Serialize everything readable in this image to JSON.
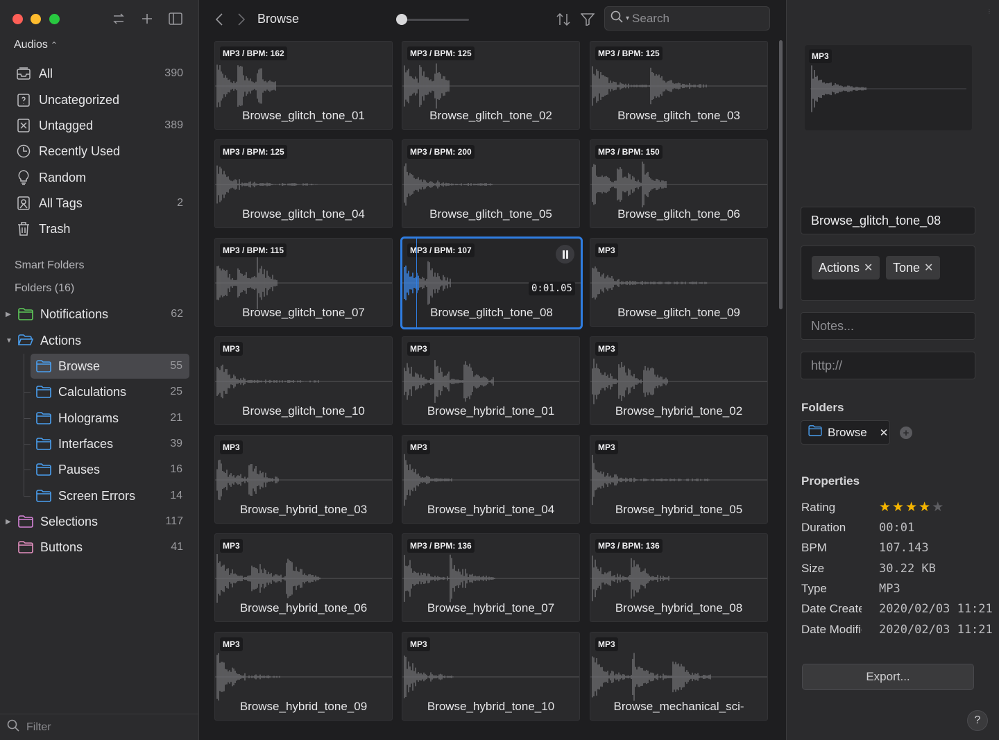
{
  "sidebar": {
    "library": "Audios",
    "library_items": [
      {
        "label": "All",
        "count": "390",
        "icon": "tray-icon"
      },
      {
        "label": "Uncategorized",
        "count": "",
        "icon": "question-folder-icon"
      },
      {
        "label": "Untagged",
        "count": "389",
        "icon": "untagged-icon"
      },
      {
        "label": "Recently Used",
        "count": "",
        "icon": "clock-icon"
      },
      {
        "label": "Random",
        "count": "",
        "icon": "lightbulb-icon"
      },
      {
        "label": "All Tags",
        "count": "2",
        "icon": "tags-icon"
      },
      {
        "label": "Trash",
        "count": "",
        "icon": "trash-icon"
      }
    ],
    "smart_folders": "Smart Folders",
    "folders_header": "Folders (16)",
    "folders": [
      {
        "label": "Notifications",
        "count": "62",
        "color": "#5ec95a"
      },
      {
        "label": "Actions",
        "count": "",
        "color": "#4a9ff0"
      },
      {
        "label": "Browse",
        "count": "55",
        "color": "#4a9ff0"
      },
      {
        "label": "Calculations",
        "count": "25",
        "color": "#4a9ff0"
      },
      {
        "label": "Holograms",
        "count": "21",
        "color": "#4a9ff0"
      },
      {
        "label": "Interfaces",
        "count": "39",
        "color": "#4a9ff0"
      },
      {
        "label": "Pauses",
        "count": "16",
        "color": "#4a9ff0"
      },
      {
        "label": "Screen Errors",
        "count": "14",
        "color": "#4a9ff0"
      },
      {
        "label": "Selections",
        "count": "117",
        "color": "#d784d8"
      },
      {
        "label": "Buttons",
        "count": "41",
        "color": "#e48fc0"
      }
    ],
    "filter_placeholder": "Filter"
  },
  "toolbar": {
    "title": "Browse",
    "search_placeholder": "Search"
  },
  "grid": [
    {
      "badge": "MP3 / BPM: 162",
      "name": "Browse_glitch_tone_01"
    },
    {
      "badge": "MP3 / BPM: 125",
      "name": "Browse_glitch_tone_02"
    },
    {
      "badge": "MP3 / BPM: 125",
      "name": "Browse_glitch_tone_03"
    },
    {
      "badge": "MP3 / BPM: 125",
      "name": "Browse_glitch_tone_04"
    },
    {
      "badge": "MP3 / BPM: 200",
      "name": "Browse_glitch_tone_05"
    },
    {
      "badge": "MP3 / BPM: 150",
      "name": "Browse_glitch_tone_06"
    },
    {
      "badge": "MP3 / BPM: 115",
      "name": "Browse_glitch_tone_07"
    },
    {
      "badge": "MP3 / BPM: 107",
      "name": "Browse_glitch_tone_08",
      "playing_time": "0:01.05"
    },
    {
      "badge": "MP3",
      "name": "Browse_glitch_tone_09"
    },
    {
      "badge": "MP3",
      "name": "Browse_glitch_tone_10"
    },
    {
      "badge": "MP3",
      "name": "Browse_hybrid_tone_01"
    },
    {
      "badge": "MP3",
      "name": "Browse_hybrid_tone_02"
    },
    {
      "badge": "MP3",
      "name": "Browse_hybrid_tone_03"
    },
    {
      "badge": "MP3",
      "name": "Browse_hybrid_tone_04"
    },
    {
      "badge": "MP3",
      "name": "Browse_hybrid_tone_05"
    },
    {
      "badge": "MP3",
      "name": "Browse_hybrid_tone_06"
    },
    {
      "badge": "MP3 / BPM: 136",
      "name": "Browse_hybrid_tone_07"
    },
    {
      "badge": "MP3 / BPM: 136",
      "name": "Browse_hybrid_tone_08"
    },
    {
      "badge": "MP3",
      "name": "Browse_hybrid_tone_09"
    },
    {
      "badge": "MP3",
      "name": "Browse_hybrid_tone_10"
    },
    {
      "badge": "MP3",
      "name": "Browse_mechanical_sci-"
    }
  ],
  "inspector": {
    "preview_badge": "MP3",
    "name": "Browse_glitch_tone_08",
    "tags": [
      "Actions",
      "Tone"
    ],
    "notes_placeholder": "Notes...",
    "url_placeholder": "http://",
    "folders_header": "Folders",
    "folder": "Browse",
    "properties_header": "Properties",
    "rating": 4,
    "rating_max": 5,
    "props": [
      {
        "key": "Rating",
        "value": ""
      },
      {
        "key": "Duration",
        "value": "00:01"
      },
      {
        "key": "BPM",
        "value": "107.143"
      },
      {
        "key": "Size",
        "value": "30.22 KB"
      },
      {
        "key": "Type",
        "value": "MP3"
      },
      {
        "key": "Date Created",
        "value": "2020/02/03 11:21"
      },
      {
        "key": "Date Modified",
        "value": "2020/02/03 11:21"
      }
    ],
    "export_label": "Export...",
    "help_label": "?"
  },
  "colors": {
    "accent": "#2f7de1",
    "star": "#f4b400"
  }
}
